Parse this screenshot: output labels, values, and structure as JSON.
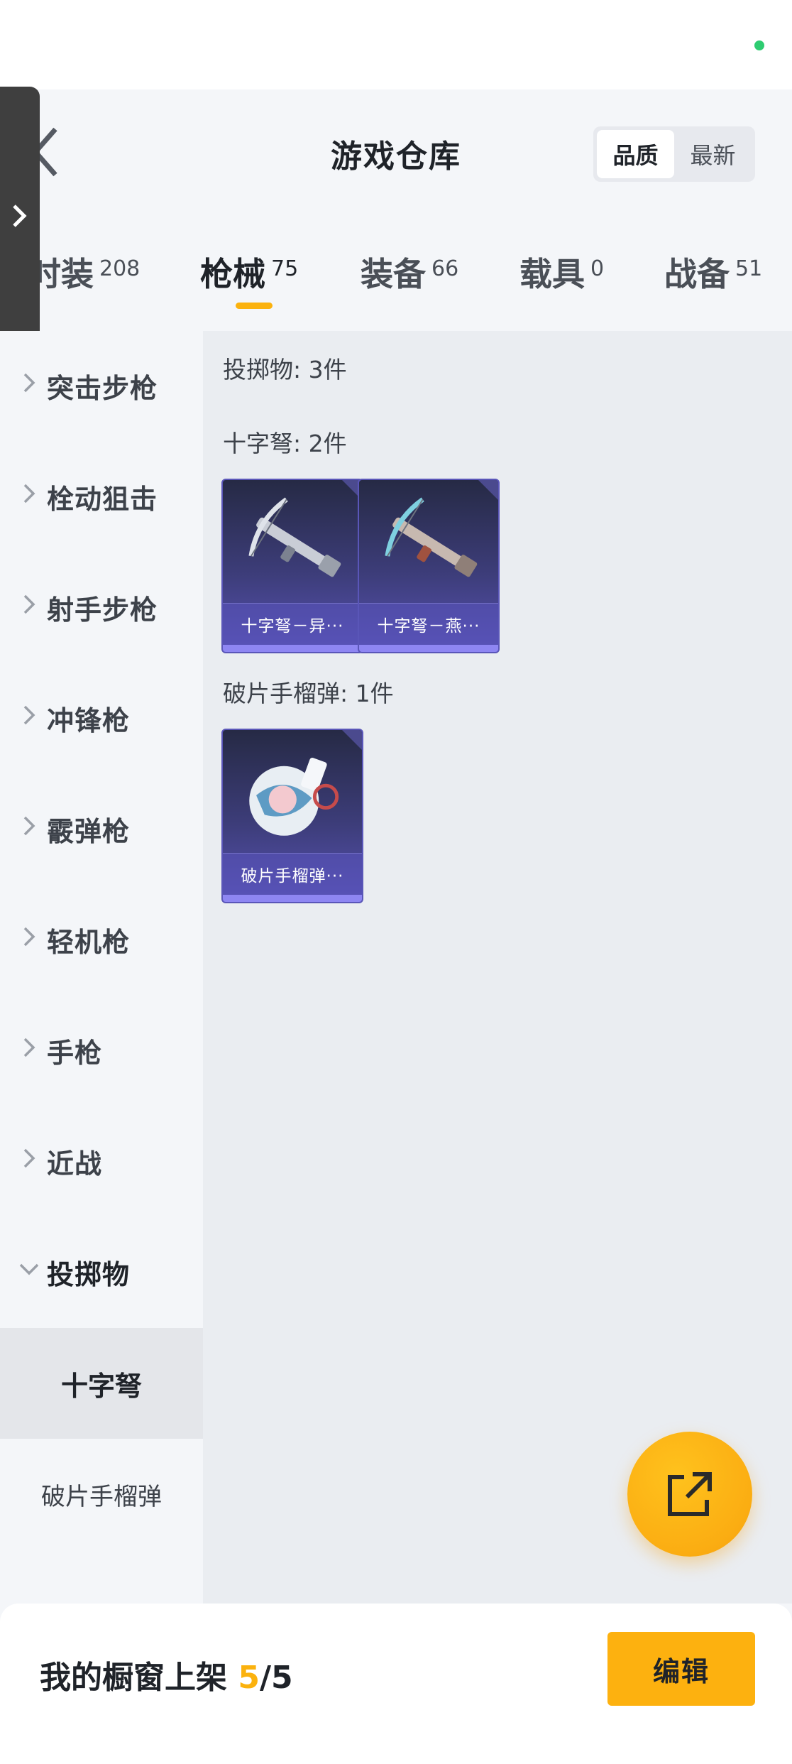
{
  "header": {
    "title": "游戏仓库",
    "sort_options": [
      "品质",
      "最新"
    ],
    "active_sort": "品质"
  },
  "tabs": [
    {
      "label": "时装",
      "count": "208",
      "visible_label": "时装"
    },
    {
      "label": "枪械",
      "count": "75",
      "active": true
    },
    {
      "label": "装备",
      "count": "66"
    },
    {
      "label": "载具",
      "count": "0"
    },
    {
      "label": "战备",
      "count": "51"
    }
  ],
  "sidebar": {
    "categories": [
      "突击步枪",
      "栓动狙击",
      "射手步枪",
      "冲锋枪",
      "霰弹枪",
      "轻机枪",
      "手枪",
      "近战",
      "投掷物"
    ],
    "expanded": "投掷物",
    "subcategories": [
      "十字弩",
      "破片手榴弹"
    ],
    "active_subcategory": "十字弩"
  },
  "content": {
    "groups": [
      {
        "label": "投掷物: 3件",
        "items": []
      },
      {
        "label": "十字弩: 2件",
        "items": [
          {
            "name": "十字弩－异···",
            "icon": "crossbow-icon"
          },
          {
            "name": "十字弩－燕···",
            "icon": "crossbow-icon"
          }
        ]
      },
      {
        "label": "破片手榴弹: 1件",
        "items": [
          {
            "name": "破片手榴弹···",
            "icon": "grenade-icon"
          }
        ]
      }
    ]
  },
  "bottom_bar": {
    "label": "我的橱窗上架 ",
    "current": "5",
    "total": "/5",
    "edit_label": "编辑"
  },
  "colors": {
    "accent": "#fbb20e",
    "card_purple": "#5752b2",
    "status_dot": "#2ecc71"
  }
}
